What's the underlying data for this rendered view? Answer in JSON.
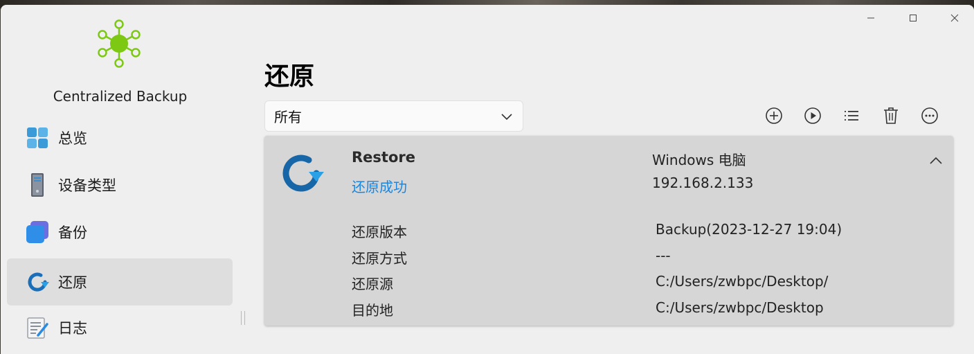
{
  "app": {
    "name": "Centralized Backup"
  },
  "sidebar": {
    "items": [
      {
        "label": "总览",
        "icon": "overview-tiles-icon"
      },
      {
        "label": "设备类型",
        "icon": "computer-tower-icon"
      },
      {
        "label": "备份",
        "icon": "backup-icon"
      },
      {
        "label": "还原",
        "icon": "restore-icon",
        "active": true
      },
      {
        "label": "日志",
        "icon": "log-notepad-icon"
      }
    ]
  },
  "page": {
    "title": "还原"
  },
  "filter": {
    "selected": "所有"
  },
  "toolbar": [
    "add-icon",
    "play-icon",
    "list-icon",
    "delete-icon",
    "more-icon"
  ],
  "task": {
    "name": "Restore",
    "status": "还原成功",
    "device": "Windows 电脑",
    "ip": "192.168.2.133",
    "details": [
      {
        "label": "还原版本",
        "value": "Backup(2023-12-27 19:04)"
      },
      {
        "label": "还原方式",
        "value": "---"
      },
      {
        "label": "还原源",
        "value": "C:/Users/zwbpc/Desktop/"
      },
      {
        "label": "目的地",
        "value": "C:/Users/zwbpc/Desktop"
      }
    ]
  },
  "colors": {
    "accent": "#1a86e0",
    "logo": "#7cc813",
    "active_nav": "#dedede"
  }
}
